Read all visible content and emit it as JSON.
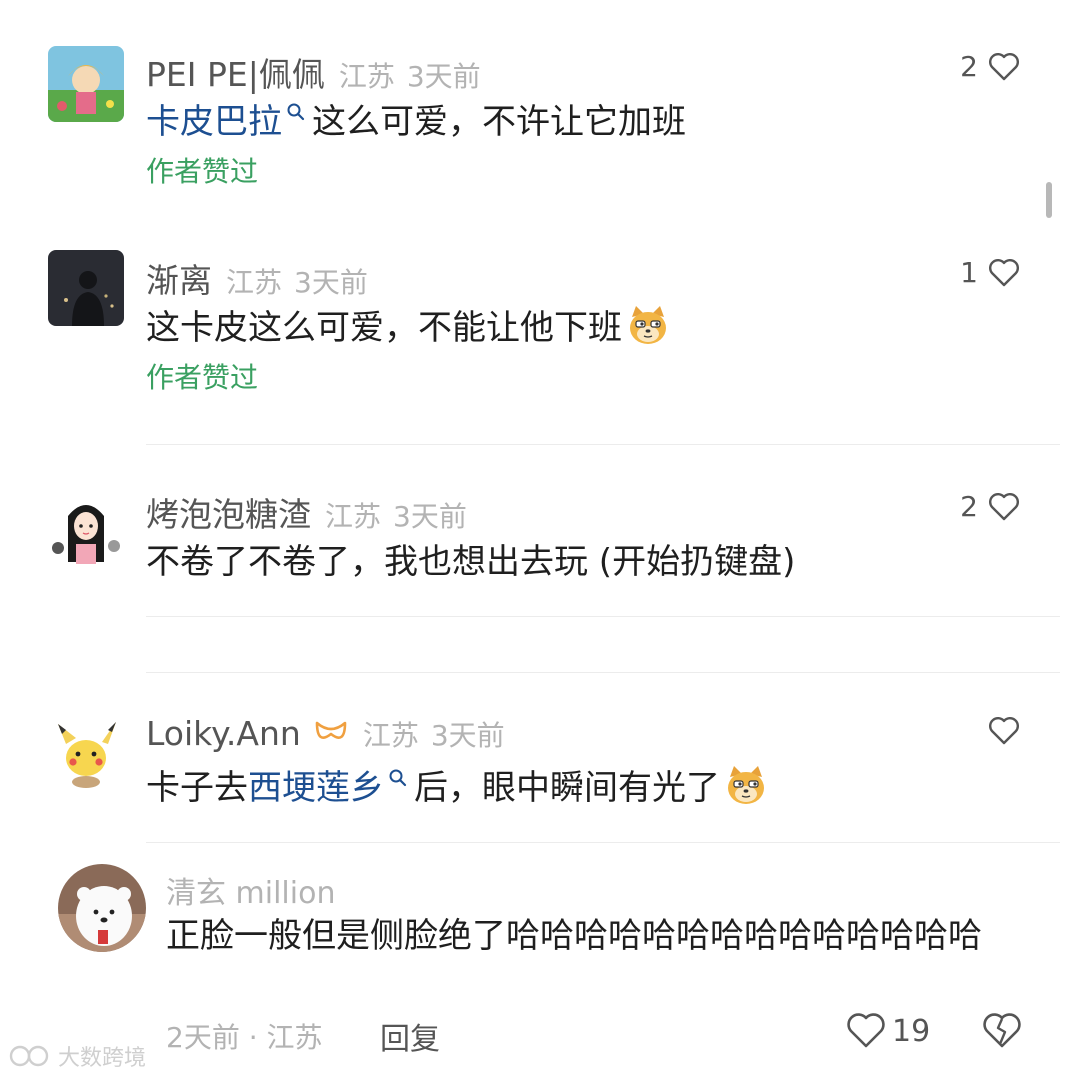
{
  "comments": [
    {
      "user": "PEI PE|佩佩",
      "location": "江苏",
      "time": "3天前",
      "likes": "2",
      "text_link": "卡皮巴拉",
      "text_rest": "这么可爱，不许让它加班",
      "badge": "作者赞过"
    },
    {
      "user": "渐离",
      "location": "江苏",
      "time": "3天前",
      "likes": "1",
      "text": "这卡皮这么可爱，不能让他下班",
      "badge": "作者赞过"
    },
    {
      "user": "烤泡泡糖渣",
      "location": "江苏",
      "time": "3天前",
      "likes": "2",
      "text": "不卷了不卷了，我也想出去玩 (开始扔键盘)"
    },
    {
      "user": "Loiky.Ann",
      "location": "江苏",
      "time": "3天前",
      "likes": "",
      "text_pre": "卡子去",
      "text_link": "西埂莲乡",
      "text_post": "后，眼中瞬间有光了"
    }
  ],
  "reply": {
    "user": "清玄 million",
    "text": "正脸一般但是侧脸绝了哈哈哈哈哈哈哈哈哈哈哈哈哈哈",
    "time": "2天前",
    "location": "江苏",
    "meta_sep": "·",
    "reply_label": "回复",
    "likes": "19"
  },
  "watermark": "大数跨境",
  "icons": [
    "heart-icon",
    "search-icon",
    "doge-emoji",
    "broken-heart-icon",
    "vip-badge-icon"
  ],
  "colors": {
    "link": "#1d4f91",
    "liked_badge": "#3aa061",
    "muted": "#b3b3b3"
  }
}
